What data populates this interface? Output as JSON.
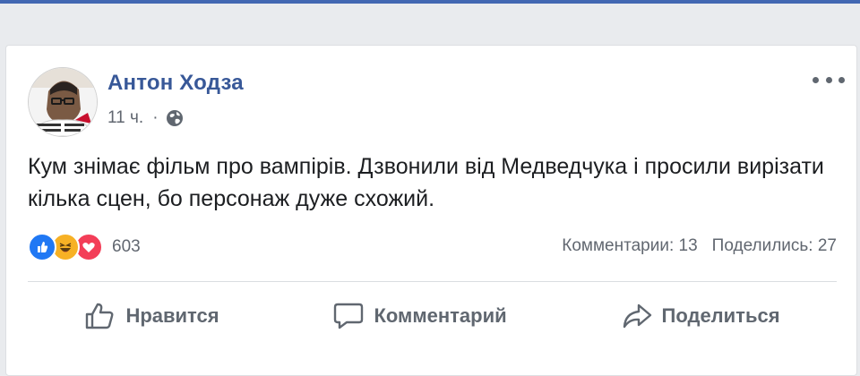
{
  "post": {
    "author": "Антон Ходза",
    "time": "11 ч.",
    "separator": "·",
    "privacy_icon": "globe-icon",
    "text": "Кум знімає фільм про вампірів. Дзвонили від Медведчука і просили вирізати кілька сцен, бо персонаж дуже схожий."
  },
  "reactions": {
    "icons": [
      "like-icon",
      "haha-icon",
      "love-icon"
    ],
    "count": "603"
  },
  "stats": {
    "comments": "Комментарии: 13",
    "shares": "Поделились: 27"
  },
  "actions": {
    "like": "Нравится",
    "comment": "Комментарий",
    "share": "Поделиться"
  },
  "colors": {
    "brand": "#4267b2",
    "author": "#385898",
    "like": "#2078f4",
    "haha": "#f7b125",
    "love": "#f33e58"
  }
}
